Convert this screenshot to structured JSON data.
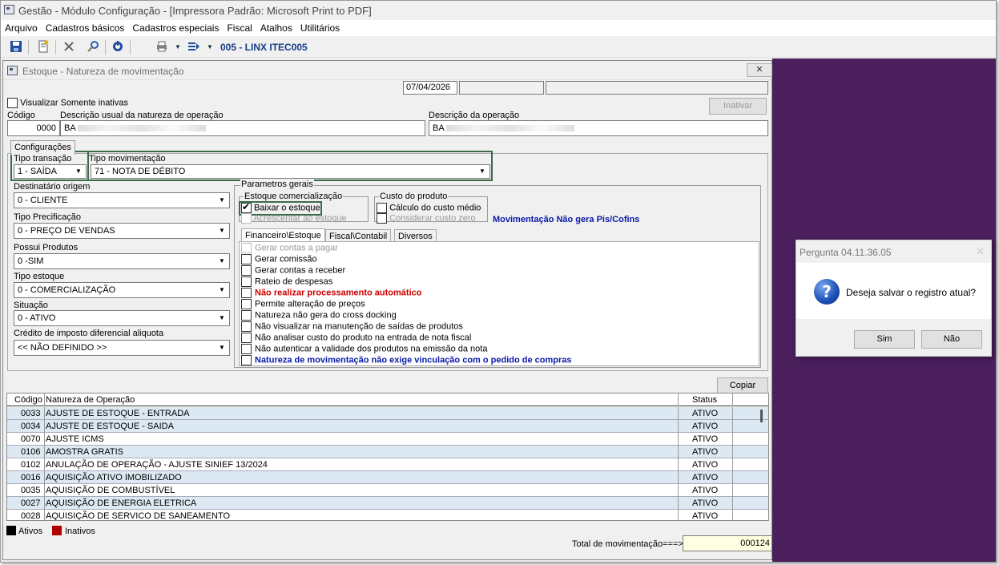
{
  "app": {
    "title": "Gestão  - Módulo Configuração - [Impressora Padrão: Microsoft Print to PDF]",
    "company": "005 - LINX ITEC005"
  },
  "menu": [
    "Arquivo",
    "Cadastros básicos",
    "Cadastros especiais",
    "Fiscal",
    "Atalhos",
    "Utilitários"
  ],
  "toolbar_icons": [
    "save-icon",
    "new-document-icon",
    "delete-icon",
    "search-icon",
    "refresh-icon",
    "print-icon",
    "export-icon"
  ],
  "window": {
    "title": "Estoque - Natureza de movimentação",
    "close": "✕",
    "date": "07/04/2026",
    "only_inactive_label": "Visualizar Somente inativas",
    "inactivate_button": "Inativar",
    "code_label": "Código",
    "code_value": "0000",
    "usual_desc_label": "Descrição usual da natureza de operação",
    "usual_desc_value": "BA",
    "op_desc_label": "Descrição da operação",
    "op_desc_value": "BA"
  },
  "config": {
    "tab_label": "Configurações",
    "tipo_transacao_label": "Tipo transação",
    "tipo_transacao_value": "1 - SAÍDA",
    "tipo_mov_label": "Tipo movimentação",
    "tipo_mov_value": "71 - NOTA DE DÉBITO",
    "destinatario_label": "Destinatário origem",
    "destinatario_value": "0 - CLIENTE",
    "tipo_precificacao_label": "Tipo Precificação",
    "tipo_precificacao_value": "0 - PREÇO DE VENDAS",
    "possui_produtos_label": "Possui Produtos",
    "possui_produtos_value": "0 -SIM",
    "tipo_estoque_label": "Tipo estoque",
    "tipo_estoque_value": "0 - COMERCIALIZAÇÃO",
    "situacao_label": "Situação",
    "situacao_value": "0 - ATIVO",
    "credito_label": "Crédito de imposto diferencial aliquota",
    "credito_value": "<< NÃO DEFINIDO >>"
  },
  "params": {
    "title": "Parametros gerais",
    "estoque_title": "Estoque comercialização",
    "baixar": "Baixar o estoque",
    "acrescentar": "Acrescentar ao estoque",
    "custo_title": "Custo do produto",
    "calculo": "Cálculo do custo médio",
    "considerar": "Considerar custo zero",
    "note": "Movimentação Não gera Pis/Cofins",
    "tabs": [
      "Financeiro\\Estoque",
      "Fiscal\\Contabil",
      "Diversos"
    ],
    "options": [
      "Gerar contas a pagar",
      "Gerar comissão",
      "Gerar contas a receber",
      "Rateio de despesas",
      "Não realizar processamento automático",
      "Permite alteração de preços",
      "Natureza não gera do cross docking",
      "Não visualizar na manutenção de saídas de produtos",
      "Não analisar custo do produto na entrada de nota fiscal",
      "Não autenticar a validade dos produtos na emissão da nota",
      "Natureza de movimentação não exige vinculação com o pedido de compras"
    ]
  },
  "grid": {
    "copy_button": "Copiar",
    "headers": [
      "Código",
      "Natureza de Operação",
      "Status"
    ],
    "rows": [
      [
        "0033",
        "AJUSTE DE ESTOQUE - ENTRADA",
        "ATIVO"
      ],
      [
        "0034",
        "AJUSTE DE ESTOQUE - SAIDA",
        "ATIVO"
      ],
      [
        "0070",
        "AJUSTE ICMS",
        "ATIVO"
      ],
      [
        "0106",
        "AMOSTRA GRATIS",
        "ATIVO"
      ],
      [
        "0102",
        "ANULAÇÃO DE OPERAÇÃO - AJUSTE SINIEF 13/2024",
        "ATIVO"
      ],
      [
        "0016",
        "AQUISIÇÃO ATIVO IMOBILIZADO",
        "ATIVO"
      ],
      [
        "0035",
        "AQUISIÇÃO DE COMBUSTÍVEL",
        "ATIVO"
      ],
      [
        "0027",
        "AQUISIÇÃO DE ENERGIA ELETRICA",
        "ATIVO"
      ],
      [
        "0028",
        "AQUISIÇÃO DE SERVICO DE SANEAMENTO",
        "ATIVO"
      ]
    ],
    "legend_active": "Ativos",
    "legend_inactive": "Inativos",
    "total_label": "Total de movimentação===>",
    "total_value": "000124"
  },
  "dialog": {
    "title": "Pergunta 04.11.36.05",
    "close": "✕",
    "message": "Deseja salvar o registro atual?",
    "yes": "Sim",
    "no": "Não"
  },
  "colors": {
    "purple_bg": "#4a1f5c",
    "highlight_border": "#3b6b4b",
    "red_text": "#cc0000",
    "blue_text": "#0a1aa8",
    "row_alt": "#dce9f2",
    "active_legend": "#000000",
    "inactive_legend": "#b00000"
  }
}
